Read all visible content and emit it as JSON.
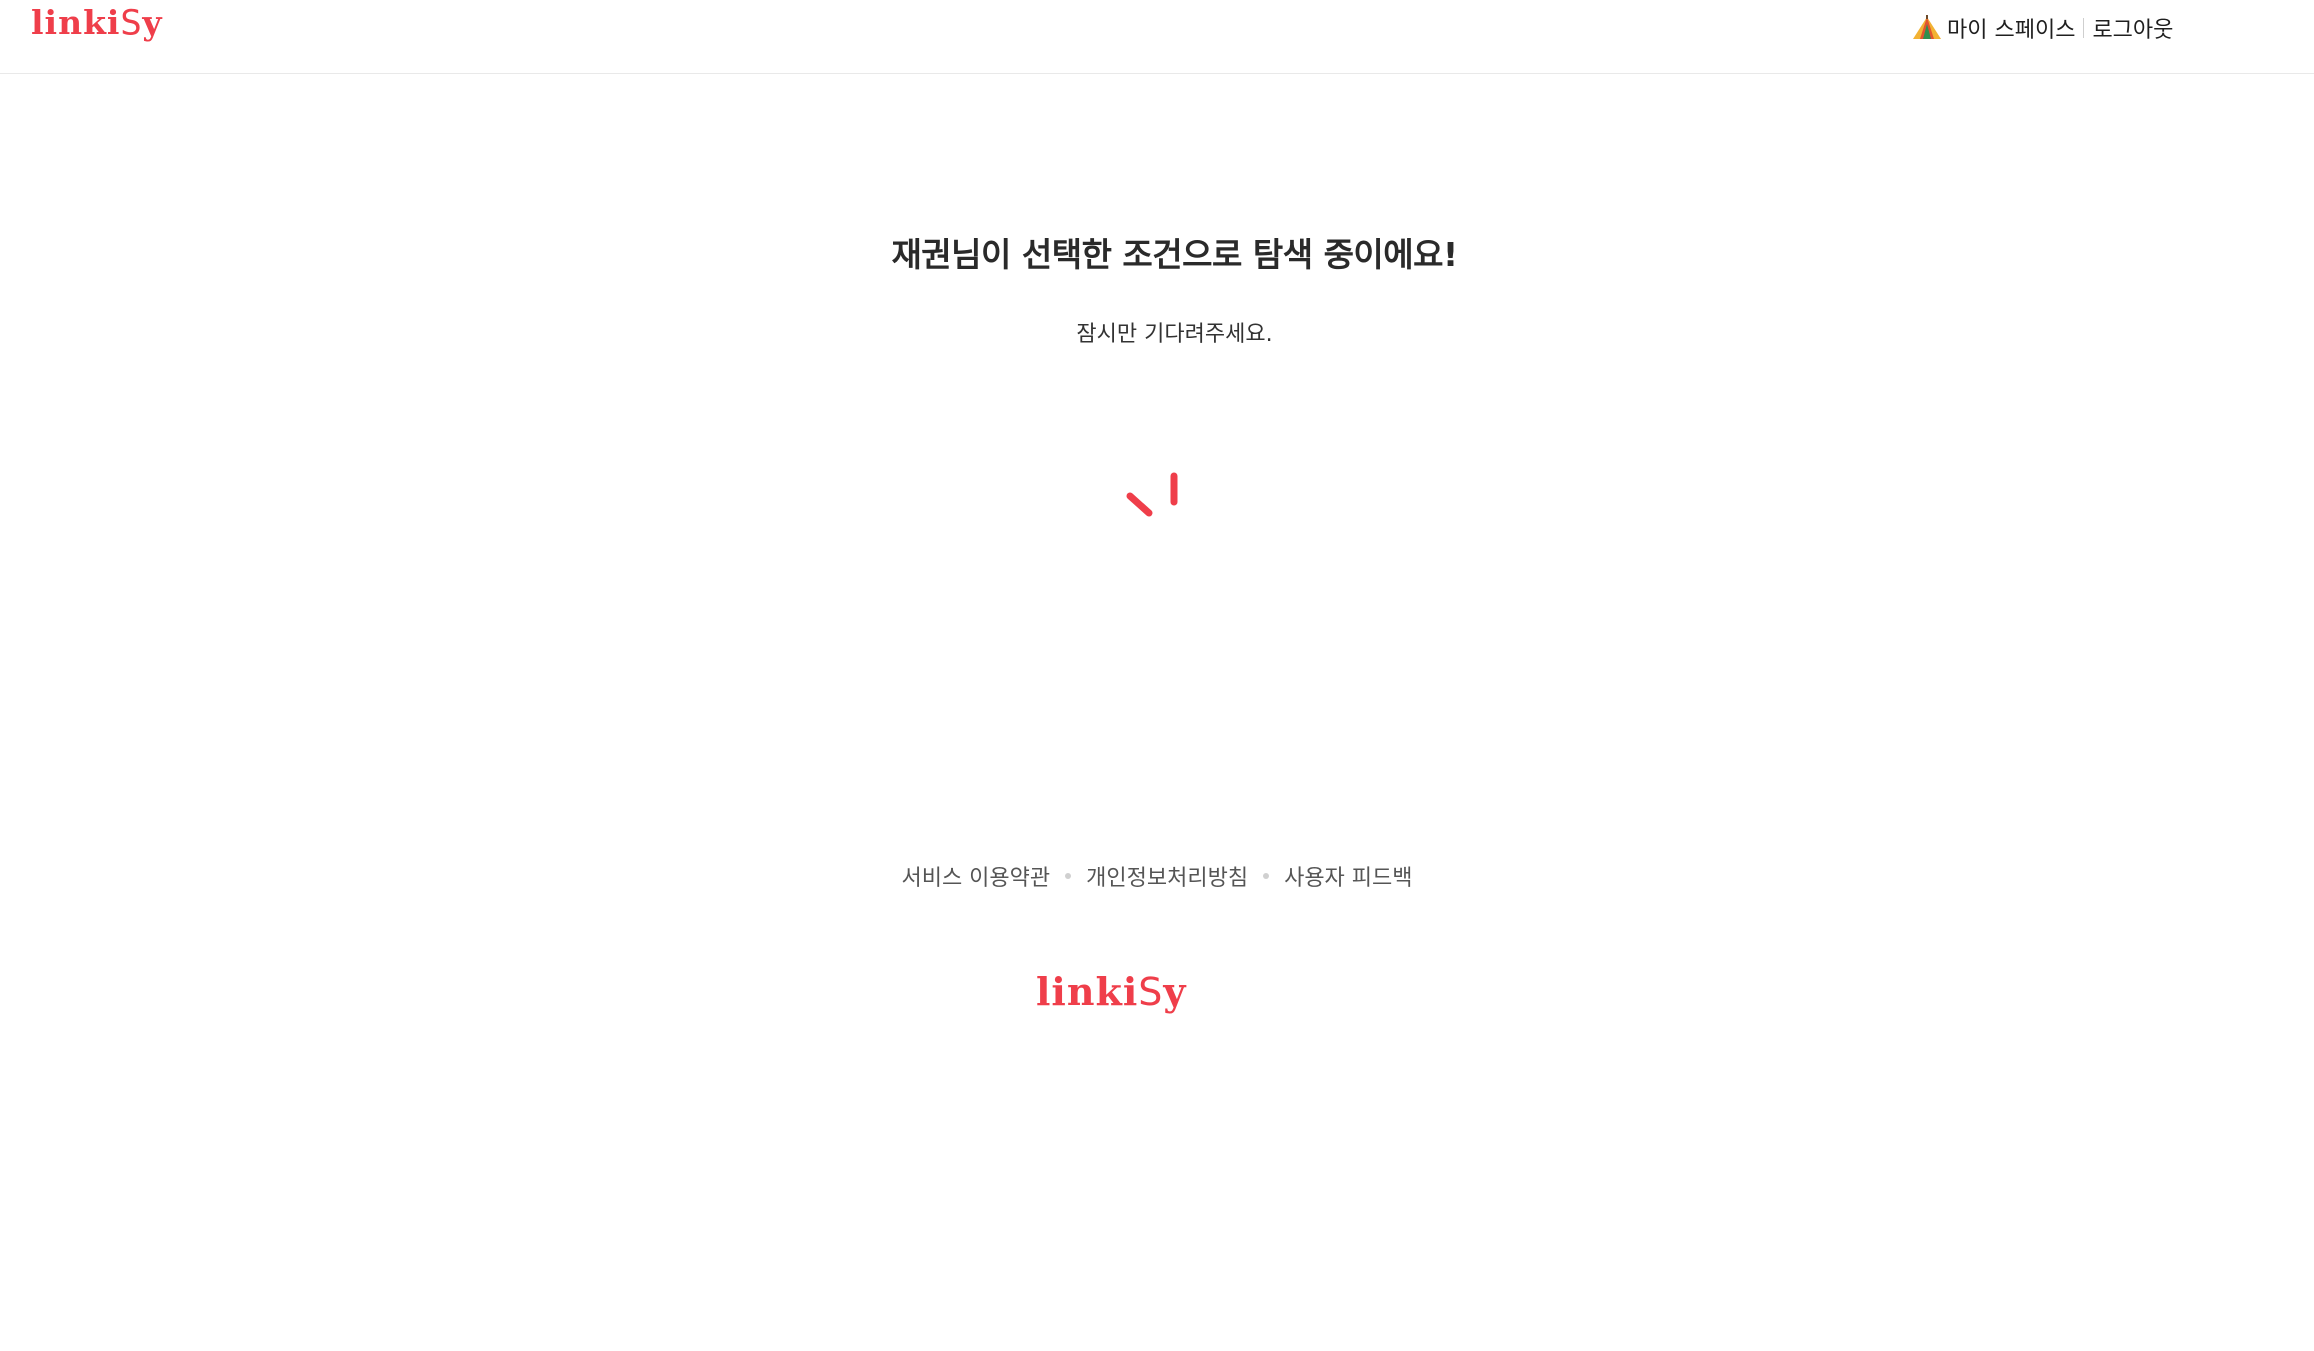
{
  "brand": {
    "logo_prefix": "linki",
    "logo_s": "S",
    "logo_suffix": "y",
    "color": "#ef3e4a"
  },
  "header": {
    "nav": {
      "myspace_icon": "tent-icon",
      "myspace_label": "마이 스페이스",
      "logout_label": "로그아웃"
    }
  },
  "main": {
    "title": "재권님이 선택한 조건으로 탐색 중이에요!",
    "subtitle": "잠시만 기다려주세요.",
    "spinner_icon": "loading-spinner-icon",
    "spinner_color": "#ef3e4a"
  },
  "footer": {
    "links": {
      "terms": "서비스 이용약관",
      "privacy": "개인정보처리방침",
      "feedback": "사용자 피드백"
    }
  }
}
